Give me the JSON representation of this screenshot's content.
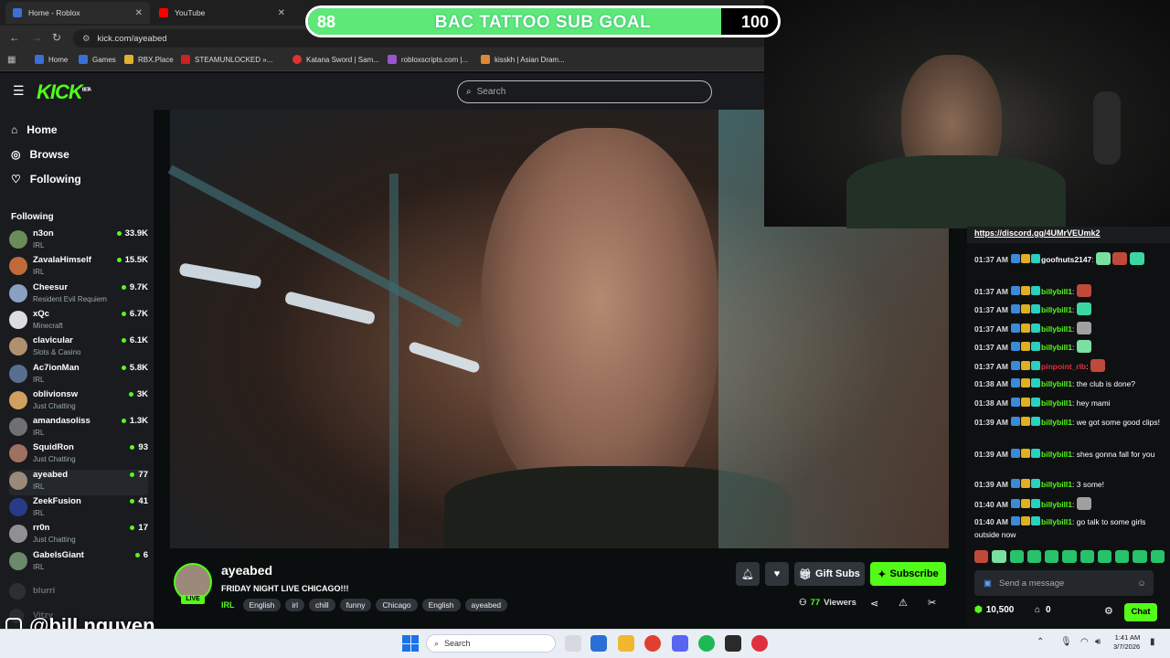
{
  "browser": {
    "tabs": [
      {
        "title": "Home - Roblox",
        "favicon_color": "#3a6fd8"
      },
      {
        "title": "YouTube",
        "favicon_color": "#ff0000"
      }
    ],
    "url": "kick.com/ayeabed",
    "bookmarks": [
      {
        "label": "Home",
        "color": "#3a6fd8"
      },
      {
        "label": "Games",
        "color": "#3a6fd8"
      },
      {
        "label": "RBX.Place",
        "color": "#e0b030"
      },
      {
        "label": "STEAMUNLOCKED »...",
        "color": "#cc2222"
      },
      {
        "label": "Katana Sword | Sam...",
        "color": "#dd3333"
      },
      {
        "label": "robloxscripts.com |...",
        "color": "#9955cc"
      },
      {
        "label": "kisskh | Asian Dram...",
        "color": "#dd8833"
      }
    ]
  },
  "sub_goal": {
    "current": "88",
    "title": "BAC TATTOO SUB GOAL",
    "target": "100",
    "progress_fraction": 0.88
  },
  "header": {
    "logo": "KICK",
    "logo_sup": "BETA",
    "search_placeholder": "Search"
  },
  "sidebar": {
    "nav": [
      {
        "label": "Home",
        "icon": "home-icon"
      },
      {
        "label": "Browse",
        "icon": "compass-icon"
      },
      {
        "label": "Following",
        "icon": "heart-icon"
      }
    ],
    "following_label": "Following",
    "channels": [
      {
        "name": "n3on",
        "category": "IRL",
        "viewers": "33.9K",
        "color": "#6a8c5a"
      },
      {
        "name": "ZavalaHimself",
        "category": "IRL",
        "viewers": "15.5K",
        "color": "#c06a3a"
      },
      {
        "name": "Cheesur",
        "category": "Resident Evil Requiem",
        "viewers": "9.7K",
        "color": "#8aa0c0"
      },
      {
        "name": "xQc",
        "category": "Minecraft",
        "viewers": "6.7K",
        "color": "#dddddd"
      },
      {
        "name": "clavicular",
        "category": "Slots & Casino",
        "viewers": "6.1K",
        "color": "#b09070"
      },
      {
        "name": "Ac7ionMan",
        "category": "IRL",
        "viewers": "5.8K",
        "color": "#5a6f90"
      },
      {
        "name": "oblivionsw",
        "category": "Just Chatting",
        "viewers": "3K",
        "color": "#d0a060"
      },
      {
        "name": "amandasoliss",
        "category": "IRL",
        "viewers": "1.3K",
        "color": "#707070"
      },
      {
        "name": "SquidRon",
        "category": "Just Chatting",
        "viewers": "93",
        "color": "#a07060"
      },
      {
        "name": "ayeabed",
        "category": "IRL",
        "viewers": "77",
        "color": "#9b8a7a",
        "active": true
      },
      {
        "name": "ZeekFusion",
        "category": "IRL",
        "viewers": "41",
        "color": "#2a3a8a"
      },
      {
        "name": "rr0n",
        "category": "Just Chatting",
        "viewers": "17",
        "color": "#909090"
      },
      {
        "name": "GabelsGiant",
        "category": "IRL",
        "viewers": "6",
        "color": "#6a8a6a"
      }
    ],
    "offline": [
      {
        "name": "blurri",
        "color": "#555555"
      },
      {
        "name": "Vitzy",
        "color": "#555555"
      }
    ]
  },
  "stream": {
    "channel": "ayeabed",
    "live_label": "LIVE",
    "title": "FRIDAY NIGHT LIVE CHICAGO!!!",
    "category": "IRL",
    "tags": [
      "English",
      "irl",
      "chill",
      "funny",
      "Chicago",
      "English",
      "ayeabed"
    ],
    "gift_label": "Gift Subs",
    "subscribe_label": "Subscribe",
    "viewers": "77",
    "viewers_label": "Viewers"
  },
  "chat": {
    "pinned_link": "https://discord.gg/4UMrVEUmk2",
    "messages": [
      {
        "time": "01:37 AM",
        "user": "goofnuts2147",
        "text": "",
        "user_color": "#ffffff",
        "emotes": 3
      },
      {
        "time": "01:37 AM",
        "user": "billybill1",
        "text": "",
        "user_color": "#53fc18",
        "emotes": 1
      },
      {
        "time": "01:37 AM",
        "user": "billybill1",
        "text": "",
        "user_color": "#53fc18",
        "emotes": 1
      },
      {
        "time": "01:37 AM",
        "user": "billybill1",
        "text": "",
        "user_color": "#53fc18",
        "emotes": 1
      },
      {
        "time": "01:37 AM",
        "user": "billybill1",
        "text": "",
        "user_color": "#53fc18",
        "emotes": 1
      },
      {
        "time": "01:37 AM",
        "user": "pinpoint_rlb",
        "text": "",
        "user_color": "#e0303a",
        "emotes": 1
      },
      {
        "time": "01:38 AM",
        "user": "billybill1",
        "text": "the club is done?",
        "user_color": "#53fc18",
        "emotes": 0
      },
      {
        "time": "01:38 AM",
        "user": "billybill1",
        "text": "hey mami",
        "user_color": "#53fc18",
        "emotes": 0
      },
      {
        "time": "01:39 AM",
        "user": "billybill1",
        "text": "we got some good clips!",
        "user_color": "#53fc18",
        "emotes": 0
      },
      {
        "time": "01:39 AM",
        "user": "billybill1",
        "text": "shes gonna fall for you",
        "user_color": "#53fc18",
        "emotes": 0
      },
      {
        "time": "01:39 AM",
        "user": "billybill1",
        "text": "3 some!",
        "user_color": "#53fc18",
        "emotes": 0
      },
      {
        "time": "01:40 AM",
        "user": "billybill1",
        "text": "",
        "user_color": "#53fc18",
        "emotes": 1
      },
      {
        "time": "01:40 AM",
        "user": "billybill1",
        "text": "go talk to some girls outside now",
        "user_color": "#53fc18",
        "emotes": 0
      }
    ],
    "input_placeholder": "Send a message",
    "points": "10,500",
    "box_count": "0",
    "chat_button": "Chat"
  },
  "overlay": {
    "handle": "@bill.nguyen"
  },
  "taskbar": {
    "search_placeholder": "Search",
    "time": "1:41 AM",
    "date": "3/7/2026"
  },
  "colors": {
    "kick_green": "#53fc18",
    "sidebar_bg": "#191b1f",
    "page_bg": "#0b0e0f"
  }
}
